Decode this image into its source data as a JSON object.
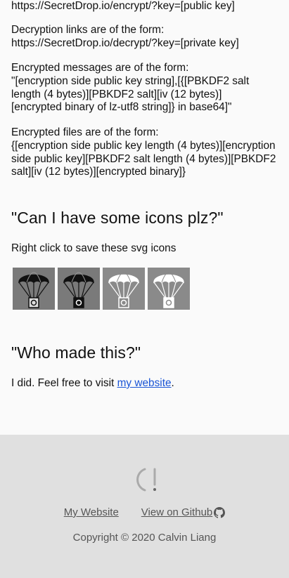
{
  "text": {
    "encrypt_url": "https://SecretDrop.io/encrypt/?key=[public key]",
    "decrypt_intro": "Decryption links are of the form:",
    "decrypt_url": "https://SecretDrop.io/decrypt/?key=[private key]",
    "messages_intro": "Encrypted messages are of the form:",
    "messages_format": "\"[encryption side public key string],[{[PBKDF2 salt length (4 bytes)][PBKDF2 salt][iv (12 bytes)][encrypted binary of lz-utf8 string]} in base64]\"",
    "files_intro": "Encrypted files are of the form:",
    "files_format": "{[encryption side public key length (4 bytes)][encryption side public key][PBKDF2 salt length (4 bytes)][PBKDF2 salt][iv (12 bytes)][encrypted binary]}"
  },
  "icons_section": {
    "heading": "\"Can I have some icons plz?\"",
    "subtext": "Right click to save these svg icons",
    "icons": [
      "parachute-dark-icon",
      "parachute-dark-icon",
      "parachute-light-icon",
      "parachute-light-icon"
    ]
  },
  "who_section": {
    "heading": "\"Who made this?\"",
    "text_before": "I did. Feel free to visit ",
    "link_text": "my website",
    "text_after": "."
  },
  "footer": {
    "link_website": "My Website",
    "link_github": "View on Github",
    "copyright": "Copyright © 2020 Calvin Liang"
  }
}
